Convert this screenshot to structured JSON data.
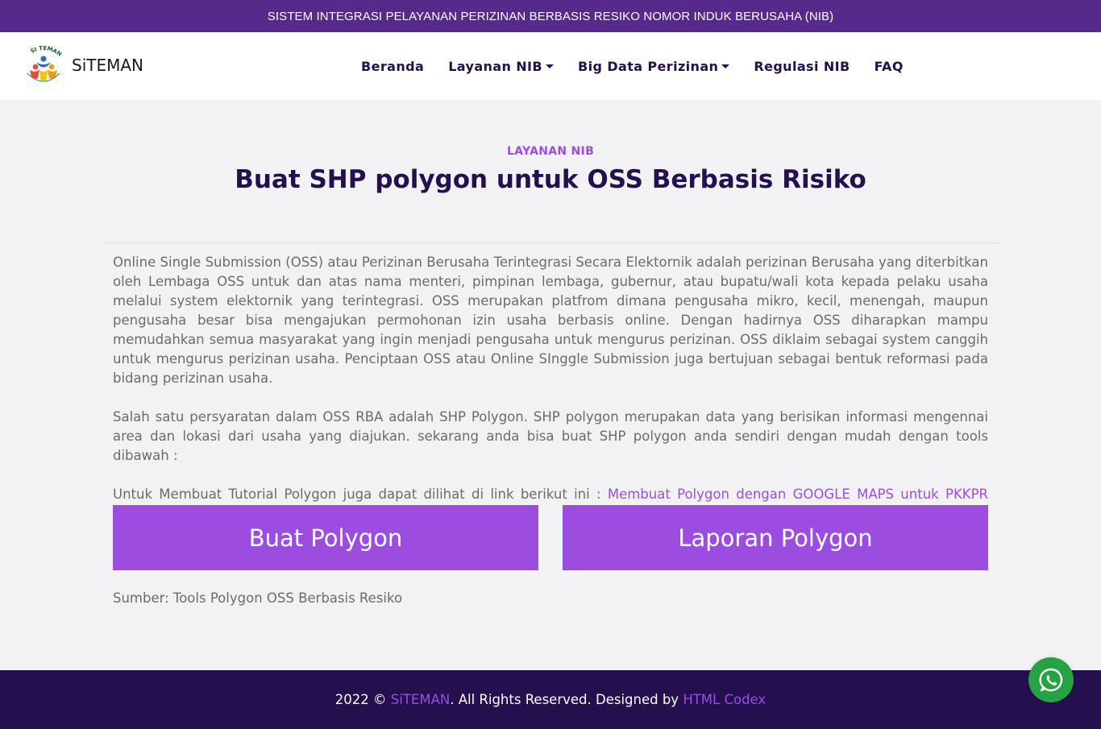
{
  "topbar": {
    "text": "SISTEM INTEGRASI PELAYANAN PERIZINAN BERBASIS RESIKO NOMOR INDUK BERUSAHA (NIB)"
  },
  "brand": {
    "name": "SiTEMAN",
    "logo_text": "SI TEMAN"
  },
  "nav": [
    {
      "label": "Beranda",
      "dropdown": false
    },
    {
      "label": "Layanan NIB",
      "dropdown": true
    },
    {
      "label": "Big Data Perizinan",
      "dropdown": true
    },
    {
      "label": "Regulasi NIB",
      "dropdown": false
    },
    {
      "label": "FAQ",
      "dropdown": false
    }
  ],
  "header": {
    "eyebrow": "LAYANAN NIB",
    "title": "Buat SHP polygon untuk OSS Berbasis Risiko"
  },
  "content": {
    "p1": "Online Single Submission (OSS) atau Perizinan Berusaha Terintegrasi Secara Elektornik adalah perizinan Berusaha yang diterbitkan oleh Lembaga OSS untuk dan atas nama menteri, pimpinan lembaga, gubernur, atau bupatu/wali kota kepada pelaku usaha melalui system elektornik yang terintegrasi. OSS merupakan platfrom dimana pengusaha mikro, kecil, menengah, maupun pengusaha besar bisa mengajukan permohonan izin usaha berbasis online. Dengan hadirnya OSS diharapkan mampu memudahkan semua masyarakat yang ingin menjadi pengusaha untuk mengurus perizinan. OSS diklaim sebagai system canggih untuk mengurus perizinan usaha. Penciptaan OSS atau Online SInggle Submission juga bertujuan sebagai bentuk reformasi pada bidang perizinan usaha.",
    "p2": "Salah satu persyaratan dalam OSS RBA adalah SHP Polygon. SHP polygon merupakan data yang berisikan informasi mengennai area dan lokasi dari usaha yang diajukan. sekarang anda bisa buat SHP polygon anda sendiri dengan mudah dengan tools dibawah :",
    "p3_prefix": "Untuk Membuat Tutorial Polygon juga dapat dilihat di link berikut ini : ",
    "p3_link": "Membuat Polygon dengan GOOGLE MAPS untuk PKKPR bekerjasama dengan Unit Pengelola PMPTSP Pondok Labu"
  },
  "buttons": {
    "create": "Buat Polygon",
    "report": "Laporan Polygon"
  },
  "source": "Sumber: Tools Polygon OSS Berbasis Resiko",
  "footer": {
    "prefix": "2022 © ",
    "brand_link": "SiTEMAN",
    "middle": ". All Rights Reserved. Designed by ",
    "designer_link": "HTML Codex"
  },
  "colors": {
    "topbar": "#562a8a",
    "accent": "#9b4ddf",
    "navy": "#24104f",
    "whatsapp": "#25a244"
  },
  "icons": {
    "whatsapp": "whatsapp-icon",
    "caret": "caret-down-icon"
  }
}
